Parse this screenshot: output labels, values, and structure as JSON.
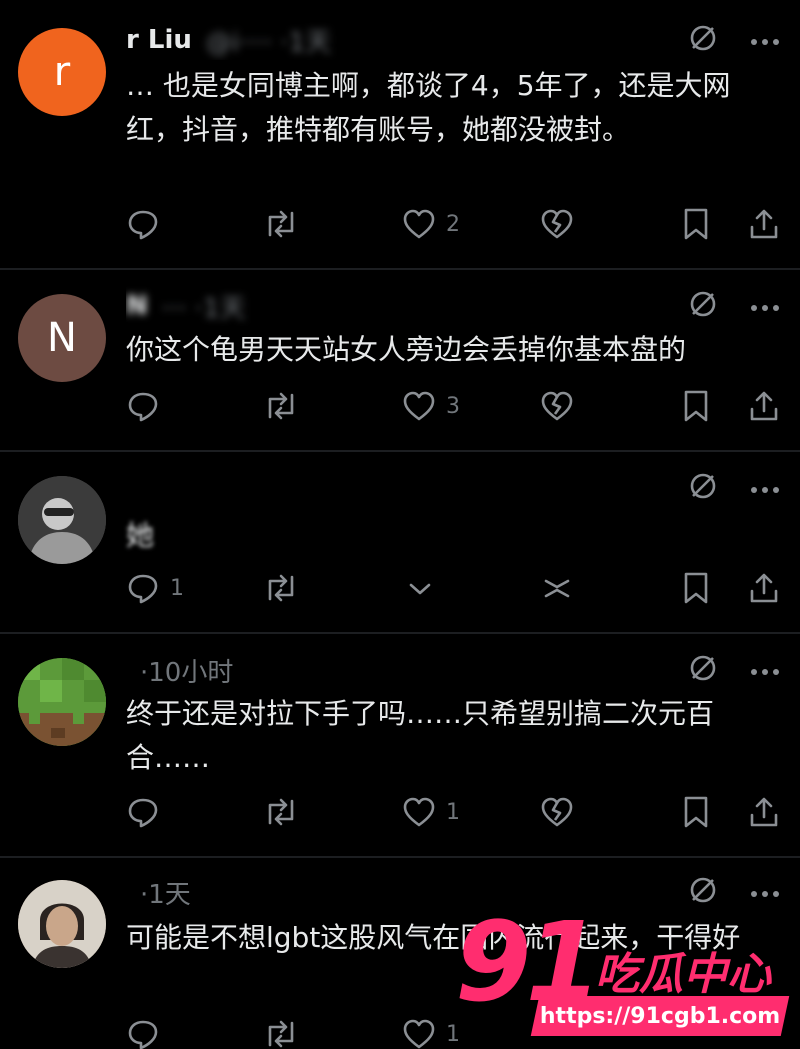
{
  "colors": {
    "background": "#000000",
    "text": "#e7e9ea",
    "muted": "#71767b",
    "watermark": "#ff2d6f"
  },
  "tweets": [
    {
      "avatar_letter": "r",
      "avatar_color": "#f0641e",
      "name": "r Liu",
      "meta": "@i···· ·1天",
      "text": "… 也是女同博主啊，都谈了4，5年了，还是大网红，抖音，推特都有账号，她都没被封。",
      "counts": {
        "reply": "",
        "retweet": "",
        "like": "2"
      }
    },
    {
      "avatar_letter": "N",
      "avatar_color": "#6d4b42",
      "name": "N",
      "meta": "··· ·1天",
      "text": "你这个龟男天天站女人旁边会丢掉你基本盘的",
      "counts": {
        "reply": "",
        "retweet": "",
        "like": "3"
      }
    },
    {
      "avatar_letter": "",
      "avatar_color": "#4a4a4a",
      "name": "",
      "meta": "",
      "text": "她",
      "counts": {
        "reply": "1",
        "retweet": "",
        "like": ""
      }
    },
    {
      "avatar_letter": "",
      "avatar_color": "#3d7a2e",
      "name": "",
      "meta": "·10小时",
      "text": "终于还是对拉下手了吗……只希望别搞二次元百合……",
      "counts": {
        "reply": "",
        "retweet": "",
        "like": "1"
      }
    },
    {
      "avatar_letter": "",
      "avatar_color": "#8a7060",
      "name": "",
      "meta": "·1天",
      "text": "可能是不想lgbt这股风气在国内流行起来，干得好",
      "counts": {
        "reply": "",
        "retweet": "",
        "like": "1"
      }
    }
  ],
  "watermark": {
    "number": "91",
    "title": "吃瓜中心",
    "url": "https://91cgb1.com"
  }
}
